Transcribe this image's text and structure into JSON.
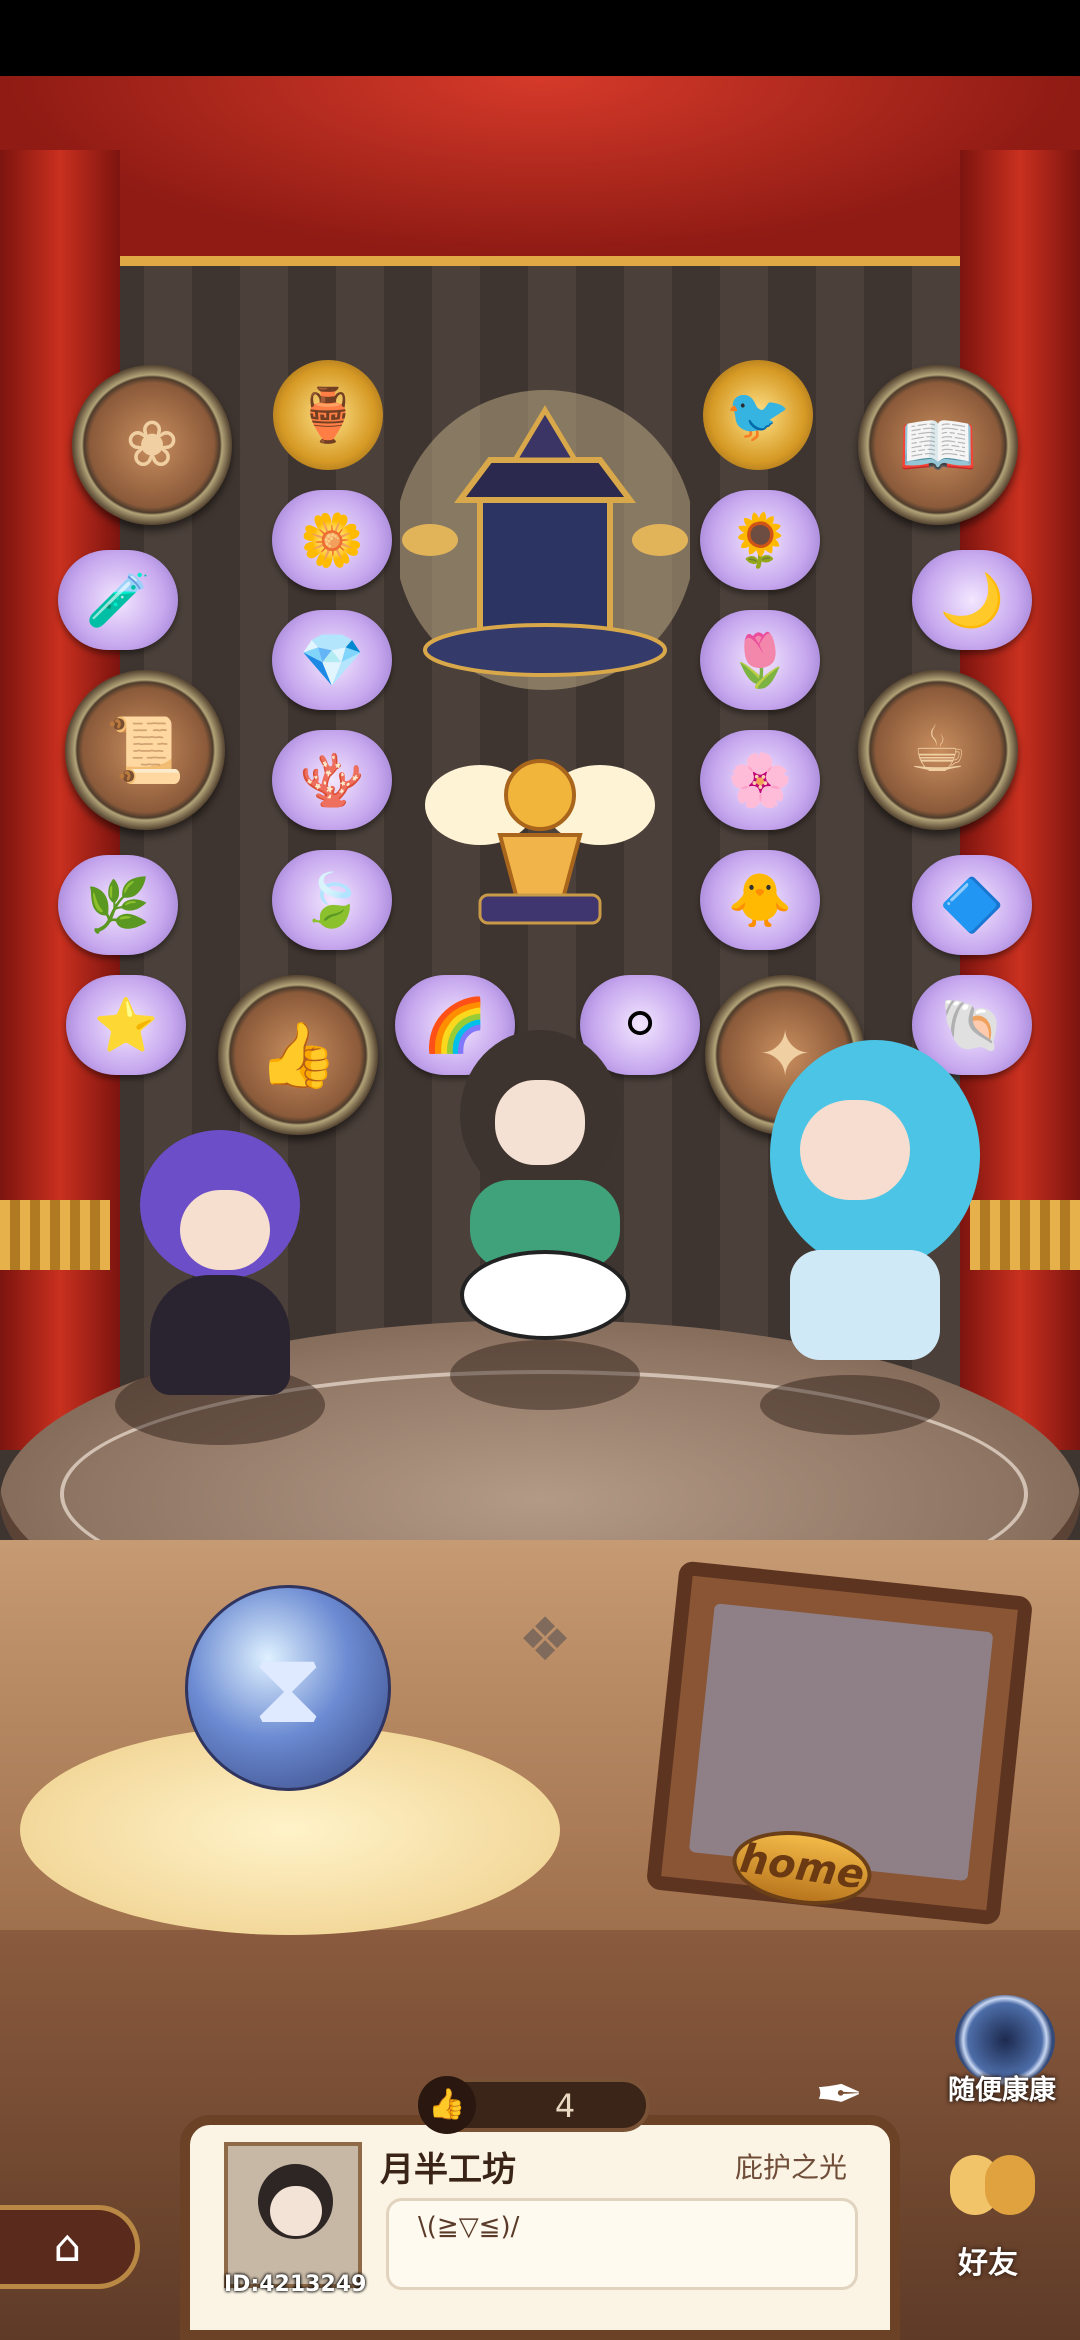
{
  "stage": {
    "home_plate_label": "home",
    "hourglass_icon": "hourglass-icon",
    "random_visit": {
      "label": "随便康康",
      "icon": "portal-icon"
    }
  },
  "emblems": [
    {
      "name": "relic-flower-emblem",
      "glyph": "❀"
    },
    {
      "name": "relic-book-emblem",
      "glyph": "📖"
    },
    {
      "name": "relic-scroll-emblem",
      "glyph": "📜"
    },
    {
      "name": "relic-pot-emblem",
      "glyph": "☕"
    },
    {
      "name": "relic-thumb-emblem",
      "glyph": "👍"
    },
    {
      "name": "relic-plate-emblem",
      "glyph": "✦"
    }
  ],
  "collectibles": [
    {
      "name": "gold-jar-icon",
      "glyph": "🏺"
    },
    {
      "name": "gold-bird-icon",
      "glyph": "🐦"
    },
    {
      "name": "flower-yellow-icon",
      "glyph": "🌼"
    },
    {
      "name": "flower-orange-icon",
      "glyph": "🌻"
    },
    {
      "name": "potion-blue-icon",
      "glyph": "🧪"
    },
    {
      "name": "moon-icon",
      "glyph": "🌙"
    },
    {
      "name": "crystal-icon",
      "glyph": "💎"
    },
    {
      "name": "lily-icon",
      "glyph": "🌷"
    },
    {
      "name": "coral-icon",
      "glyph": "🪸"
    },
    {
      "name": "blue-flower-icon",
      "glyph": "🌸"
    },
    {
      "name": "herb-icon",
      "glyph": "🌿"
    },
    {
      "name": "leaf-icon",
      "glyph": "🍃"
    },
    {
      "name": "chick-icon",
      "glyph": "🐥"
    },
    {
      "name": "shard-icon",
      "glyph": "🔷"
    },
    {
      "name": "star-icon",
      "glyph": "⭐"
    },
    {
      "name": "rainbow-icon",
      "glyph": "🌈"
    },
    {
      "name": "pearl-icon",
      "glyph": "⚪"
    },
    {
      "name": "shell-icon",
      "glyph": "🐚"
    }
  ],
  "profile": {
    "likes_count": "4",
    "workshop_name": "月半工坊",
    "title_badge": "庇护之光",
    "motto": "\\(≧▽≦)/",
    "user_id": "ID:4213249"
  },
  "nav": {
    "home_icon": "home-icon",
    "friends_label": "好友"
  }
}
